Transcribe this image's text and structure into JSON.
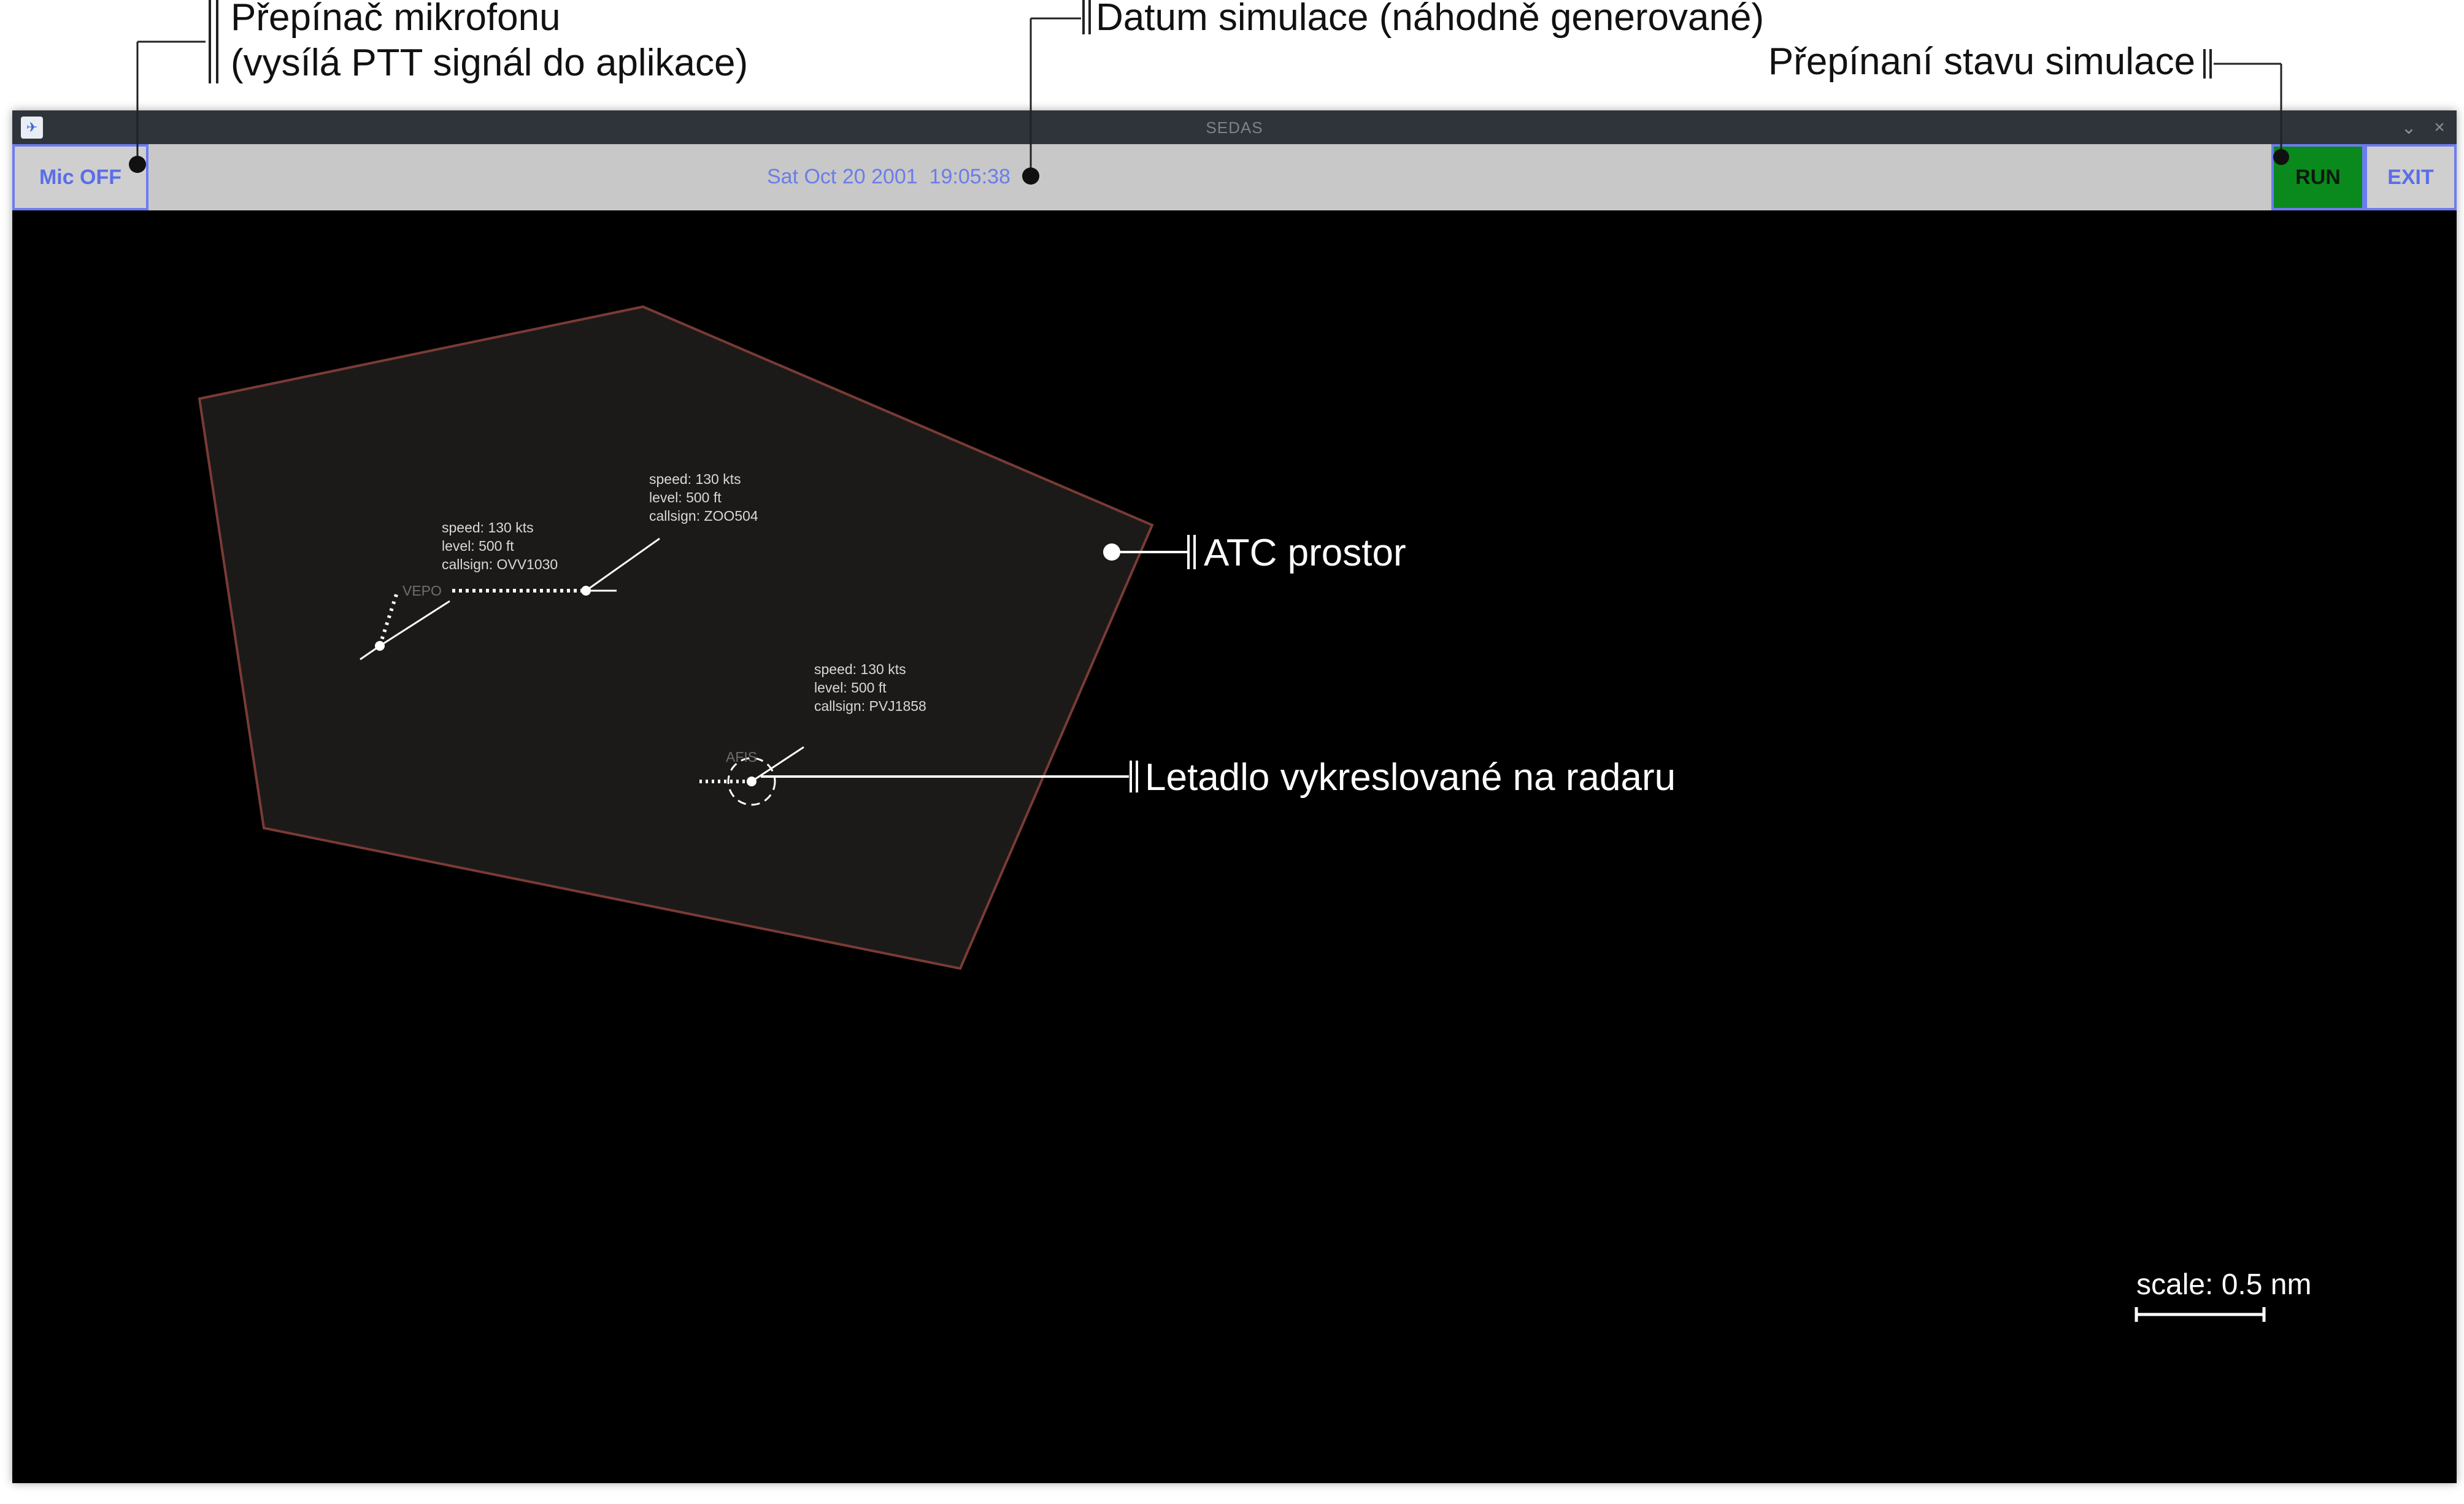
{
  "annotations": {
    "mic_toggle": {
      "line1": "Přepínač mikrofonu",
      "line2": "(vysílá PTT signál do aplikace)"
    },
    "sim_date": "Datum simulace (náhodně generované)",
    "sim_state": "Přepínaní stavu simulace",
    "atc_space": "ATC prostor",
    "aircraft": "Letadlo vykreslované na radaru"
  },
  "window": {
    "title": "SEDAS"
  },
  "toolbar": {
    "mic_label": "Mic OFF",
    "date_text": "Sat Oct 20 2001  19:05:38",
    "run_label": "RUN",
    "exit_label": "EXIT"
  },
  "radar": {
    "airspace_fill": "#1c1a19",
    "airspace_border": "#7a3b36",
    "waypoints": [
      "VEPO",
      "AFIS"
    ],
    "aircraft": [
      {
        "speed": "speed: 130 kts",
        "level": "level: 500 ft",
        "callsign": "callsign: OVV1030"
      },
      {
        "speed": "speed: 130 kts",
        "level": "level: 500 ft",
        "callsign": "callsign: ZOO504"
      },
      {
        "speed": "speed: 130 kts",
        "level": "level: 500 ft",
        "callsign": "callsign: PVJ1858"
      }
    ],
    "scale_label": "scale: 0.5 nm"
  },
  "colors": {
    "run_active": "#0a8a1c",
    "button_border": "#6c7cf0",
    "button_text": "#5a6ee8",
    "toolbar_bg": "#c8c8c8",
    "titlebar_bg": "#2f343b"
  }
}
